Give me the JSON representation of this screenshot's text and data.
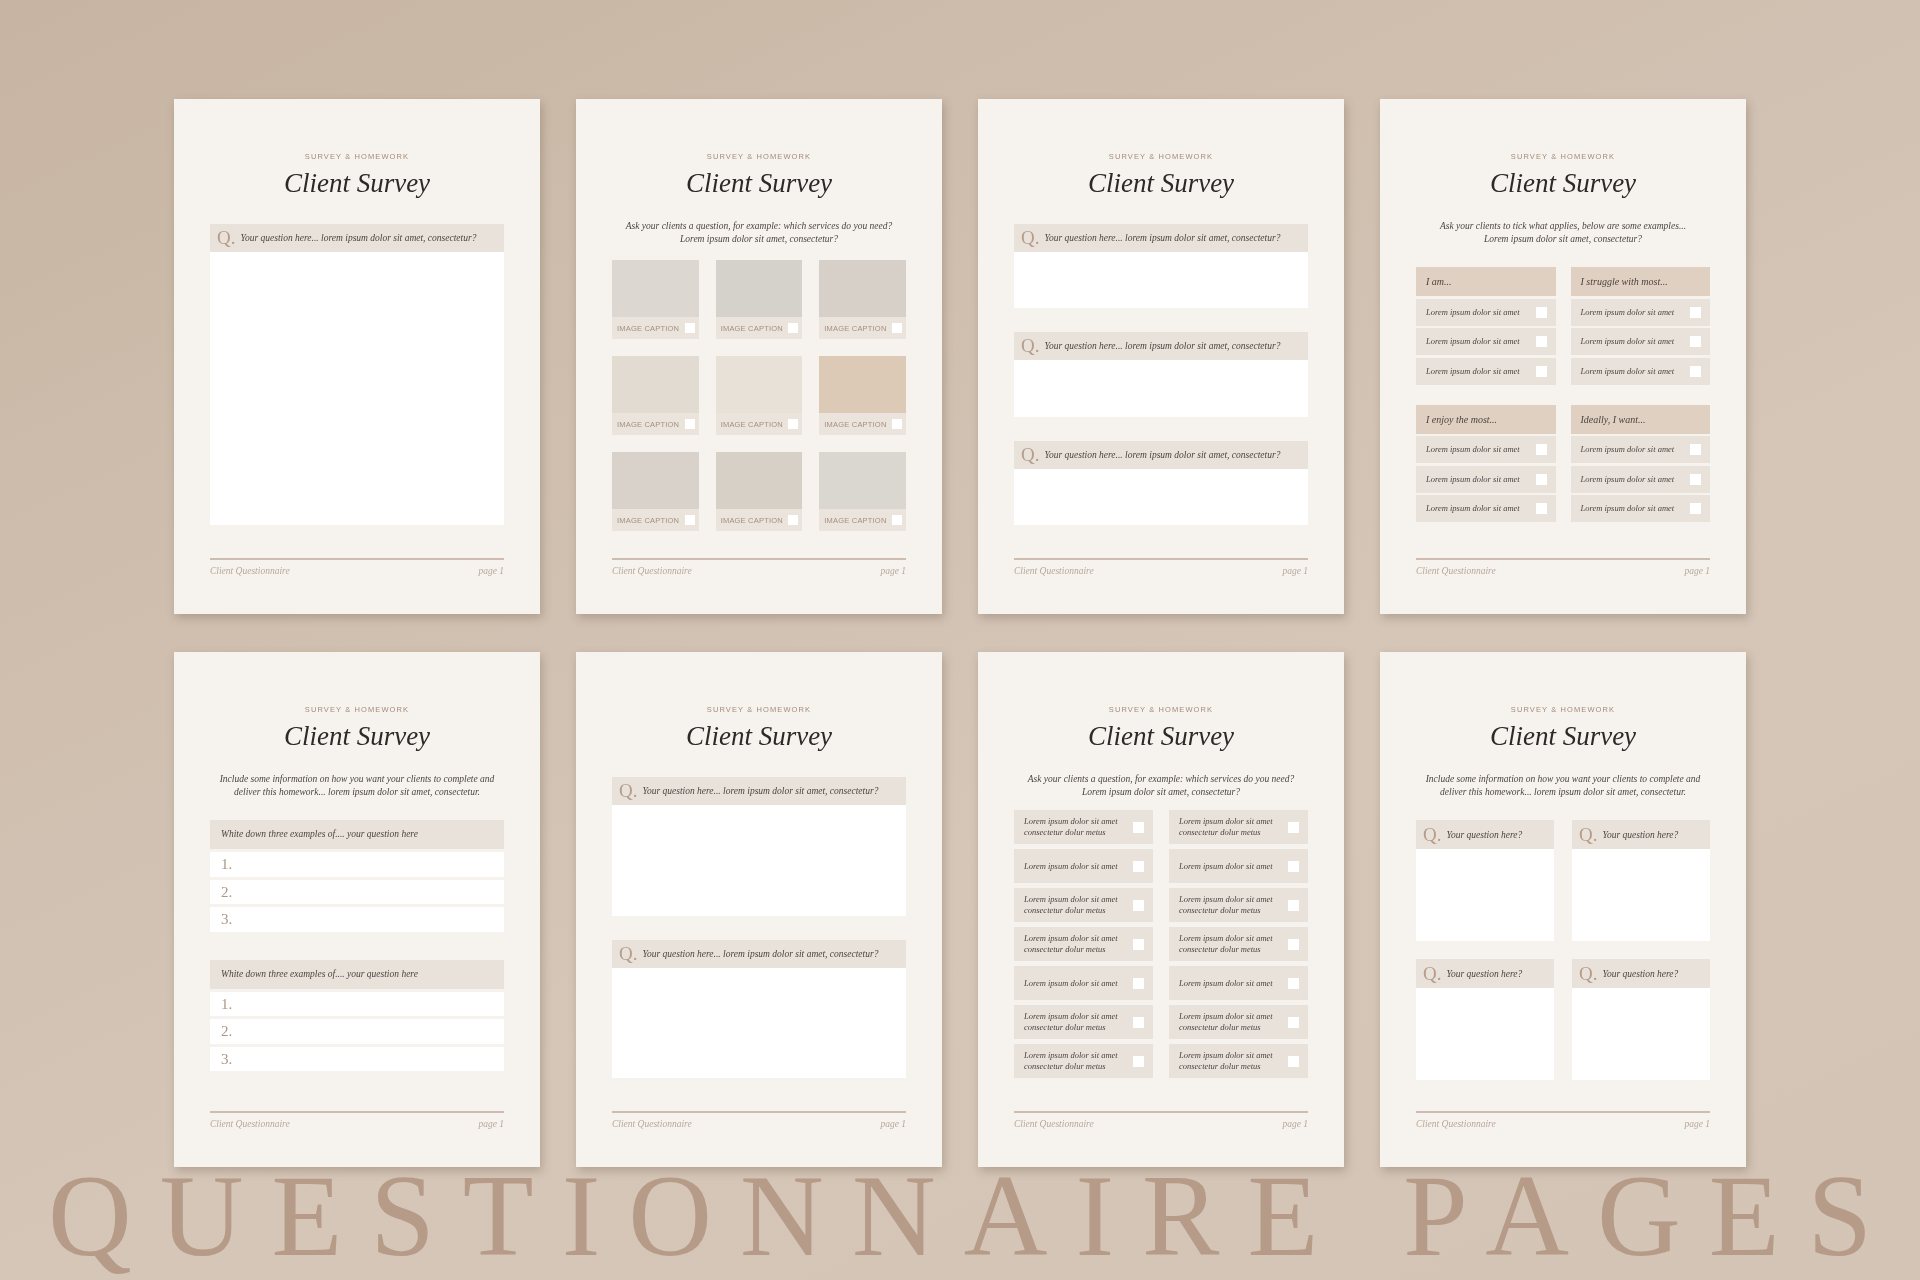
{
  "pages": [
    {
      "kind": "questions",
      "kicker": "SURVEY & HOMEWORK",
      "title": "Client Survey",
      "questions": [
        {
          "marker": "Q.",
          "text": "Your question here... lorem ipsum dolor sit amet, consectetur?"
        }
      ],
      "footer": {
        "left": "Client Questionnaire",
        "right": "page 1"
      }
    },
    {
      "kind": "image_choice",
      "kicker": "SURVEY & HOMEWORK",
      "title": "Client Survey",
      "description": "Ask your clients a question, for example: which services do you need?\nLorem ipsum dolor sit amet, consectetur?",
      "images": [
        {
          "caption": "IMAGE CAPTION",
          "checked": false
        },
        {
          "caption": "IMAGE CAPTION",
          "checked": false
        },
        {
          "caption": "IMAGE CAPTION",
          "checked": false
        },
        {
          "caption": "IMAGE CAPTION",
          "checked": false
        },
        {
          "caption": "IMAGE CAPTION",
          "checked": false
        },
        {
          "caption": "IMAGE CAPTION",
          "checked": false
        },
        {
          "caption": "IMAGE CAPTION",
          "checked": false
        },
        {
          "caption": "IMAGE CAPTION",
          "checked": false
        },
        {
          "caption": "IMAGE CAPTION",
          "checked": false
        }
      ],
      "footer": {
        "left": "Client Questionnaire",
        "right": "page 1"
      }
    },
    {
      "kind": "questions",
      "kicker": "SURVEY & HOMEWORK",
      "title": "Client Survey",
      "questions": [
        {
          "marker": "Q.",
          "text": "Your question here... lorem ipsum dolor sit amet, consectetur?"
        },
        {
          "marker": "Q.",
          "text": "Your question here... lorem ipsum dolor sit amet, consectetur?"
        },
        {
          "marker": "Q.",
          "text": "Your question here... lorem ipsum dolor sit amet, consectetur?"
        }
      ],
      "footer": {
        "left": "Client Questionnaire",
        "right": "page 1"
      }
    },
    {
      "kind": "checklist_groups",
      "kicker": "SURVEY & HOMEWORK",
      "title": "Client Survey",
      "description": "Ask your clients to tick what applies, below are some examples...\nLorem ipsum dolor sit amet, consectetur?",
      "groups": [
        {
          "heading": "I am...",
          "options": [
            {
              "text": "Lorem ipsum dolor sit amet",
              "checked": false
            },
            {
              "text": "Lorem ipsum dolor sit amet",
              "checked": false
            },
            {
              "text": "Lorem ipsum dolor sit amet",
              "checked": false
            }
          ]
        },
        {
          "heading": "I struggle with most...",
          "options": [
            {
              "text": "Lorem ipsum dolor sit amet",
              "checked": false
            },
            {
              "text": "Lorem ipsum dolor sit amet",
              "checked": false
            },
            {
              "text": "Lorem ipsum dolor sit amet",
              "checked": false
            }
          ]
        },
        {
          "heading": "I enjoy the most...",
          "options": [
            {
              "text": "Lorem ipsum dolor sit amet",
              "checked": false
            },
            {
              "text": "Lorem ipsum dolor sit amet",
              "checked": false
            },
            {
              "text": "Lorem ipsum dolor sit amet",
              "checked": false
            }
          ]
        },
        {
          "heading": "Ideally, I want...",
          "options": [
            {
              "text": "Lorem ipsum dolor sit amet",
              "checked": false
            },
            {
              "text": "Lorem ipsum dolor sit amet",
              "checked": false
            },
            {
              "text": "Lorem ipsum dolor sit amet",
              "checked": false
            }
          ]
        }
      ],
      "footer": {
        "left": "Client Questionnaire",
        "right": "page 1"
      }
    },
    {
      "kind": "numbered_lists",
      "kicker": "SURVEY & HOMEWORK",
      "title": "Client Survey",
      "description": "Include some information on how you want your clients to complete and\ndeliver this homework... lorem ipsum dolor sit amet, consectetur.",
      "prompts": [
        {
          "text": "White down three examples of.... your question here",
          "lines": [
            "1.",
            "2.",
            "3."
          ]
        },
        {
          "text": "White down three examples of.... your question here",
          "lines": [
            "1.",
            "2.",
            "3."
          ]
        }
      ],
      "footer": {
        "left": "Client Questionnaire",
        "right": "page 1"
      }
    },
    {
      "kind": "questions",
      "kicker": "SURVEY & HOMEWORK",
      "title": "Client Survey",
      "questions": [
        {
          "marker": "Q.",
          "text": "Your question here... lorem ipsum dolor sit amet, consectetur?"
        },
        {
          "marker": "Q.",
          "text": "Your question here... lorem ipsum dolor sit amet, consectetur?"
        }
      ],
      "footer": {
        "left": "Client Questionnaire",
        "right": "page 1"
      }
    },
    {
      "kind": "checklist_grid",
      "kicker": "SURVEY & HOMEWORK",
      "title": "Client Survey",
      "description": "Ask your clients a question, for example: which services do you need?\nLorem ipsum dolor sit amet, consectetur?",
      "options": [
        {
          "text": "Lorem ipsum dolor sit amet\nconsectetur dolur metus",
          "checked": false
        },
        {
          "text": "Lorem ipsum dolor sit amet\nconsectetur dolur metus",
          "checked": false
        },
        {
          "text": "Lorem ipsum dolor sit amet",
          "checked": false
        },
        {
          "text": "Lorem ipsum dolor sit amet",
          "checked": false
        },
        {
          "text": "Lorem ipsum dolor sit amet\nconsectetur dolur metus",
          "checked": false
        },
        {
          "text": "Lorem ipsum dolor sit amet\nconsectetur dolur metus",
          "checked": false
        },
        {
          "text": "Lorem ipsum dolor sit amet\nconsectetur dolur metus",
          "checked": false
        },
        {
          "text": "Lorem ipsum dolor sit amet\nconsectetur dolur metus",
          "checked": false
        },
        {
          "text": "Lorem ipsum dolor sit amet",
          "checked": false
        },
        {
          "text": "Lorem ipsum dolor sit amet",
          "checked": false
        },
        {
          "text": "Lorem ipsum dolor sit amet\nconsectetur dolur metus",
          "checked": false
        },
        {
          "text": "Lorem ipsum dolor sit amet\nconsectetur dolur metus",
          "checked": false
        },
        {
          "text": "Lorem ipsum dolor sit amet\nconsectetur dolur metus",
          "checked": false
        },
        {
          "text": "Lorem ipsum dolor sit amet\nconsectetur dolur metus",
          "checked": false
        }
      ],
      "footer": {
        "left": "Client Questionnaire",
        "right": "page 1"
      }
    },
    {
      "kind": "question_grid",
      "kicker": "SURVEY & HOMEWORK",
      "title": "Client Survey",
      "description": "Include some information on how you want your clients to complete and\ndeliver this homework... lorem ipsum dolor sit amet, consectetur.",
      "questions": [
        {
          "marker": "Q.",
          "text": "Your question here?"
        },
        {
          "marker": "Q.",
          "text": "Your question here?"
        },
        {
          "marker": "Q.",
          "text": "Your question here?"
        },
        {
          "marker": "Q.",
          "text": "Your question here?"
        }
      ],
      "footer": {
        "left": "Client Questionnaire",
        "right": "page 1"
      }
    }
  ],
  "headline": "QUESTIONNAIRE PAGES"
}
